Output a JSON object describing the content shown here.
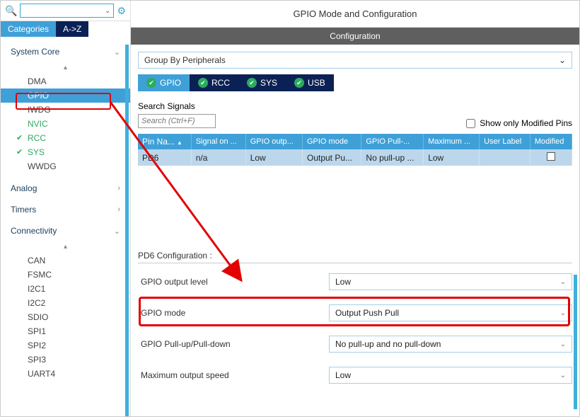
{
  "sidebar": {
    "tabs": {
      "categories": "Categories",
      "az": "A->Z"
    },
    "sections": {
      "systemCore": {
        "label": "System Core",
        "items": [
          "DMA",
          "GPIO",
          "IWDG",
          "NVIC",
          "RCC",
          "SYS",
          "WWDG"
        ]
      },
      "analog": {
        "label": "Analog"
      },
      "timers": {
        "label": "Timers"
      },
      "connectivity": {
        "label": "Connectivity",
        "items": [
          "CAN",
          "FSMC",
          "I2C1",
          "I2C2",
          "SDIO",
          "SPI1",
          "SPI2",
          "SPI3",
          "UART4"
        ]
      }
    }
  },
  "main": {
    "title": "GPIO Mode and Configuration",
    "confBand": "Configuration",
    "groupBy": "Group By Peripherals",
    "periphTabs": [
      "GPIO",
      "RCC",
      "SYS",
      "USB"
    ],
    "searchSignals": {
      "label": "Search Signals",
      "placeholder": "Search (Ctrl+F)"
    },
    "showOnlyMod": "Show only Modified Pins",
    "table": {
      "headers": [
        "Pin Na...",
        "Signal on ...",
        "GPIO outp...",
        "GPIO mode",
        "GPIO Pull-...",
        "Maximum ...",
        "User Label",
        "Modified"
      ],
      "row": {
        "pin": "PD6",
        "signal": "n/a",
        "outp": "Low",
        "mode": "Output Pu...",
        "pull": "No pull-up ...",
        "max": "Low",
        "label": "",
        "mod": false
      }
    },
    "pd6": {
      "title": "PD6 Configuration :",
      "rows": [
        {
          "label": "GPIO output level",
          "value": "Low"
        },
        {
          "label": "GPIO mode",
          "value": "Output Push Pull"
        },
        {
          "label": "GPIO Pull-up/Pull-down",
          "value": "No pull-up and no pull-down"
        },
        {
          "label": "Maximum output speed",
          "value": "Low"
        }
      ]
    }
  }
}
